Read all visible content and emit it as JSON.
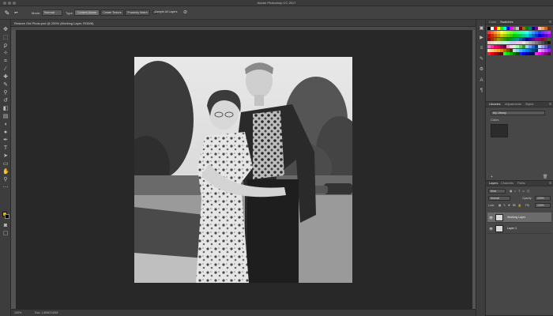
{
  "app": {
    "title": "Adobe Photoshop CC 2017"
  },
  "options_bar": {
    "mode_label": "Mode:",
    "mode_value": "Normal",
    "type_label": "Type:",
    "type_buttons": [
      "Content-Aware",
      "Create Texture",
      "Proximity Match"
    ],
    "sample_all_layers": "Sample All Layers"
  },
  "document": {
    "tab_label": "Restore Old Photo.psd @ 200% (Working Layer, RGB/8)",
    "zoom": "100%",
    "doc_info": "Doc: 1.80M/3.60M"
  },
  "panels": {
    "color_tabs": [
      "Color",
      "Swatches"
    ],
    "libraries_tabs": [
      "Libraries",
      "Adjustments",
      "Styles"
    ],
    "library_name": "My Library",
    "library_section": "Colors",
    "layers_tabs": [
      "Layers",
      "Channels",
      "Paths"
    ],
    "layers_kind": "Kind",
    "blend_mode": "Normal",
    "opacity_label": "Opacity:",
    "opacity_value": "100%",
    "lock_label": "Lock:",
    "fill_label": "Fill:",
    "fill_value": "100%",
    "layers": [
      {
        "name": "Working Layer",
        "selected": true
      },
      {
        "name": "Layer 1",
        "selected": false
      }
    ]
  },
  "swatch_colors": [
    "#000000",
    "#ffffff",
    "#ff0000",
    "#ffff00",
    "#00ff00",
    "#00ffff",
    "#0000ff",
    "#ff00ff",
    "#808080",
    "#c0c0c0",
    "#800000",
    "#808000",
    "#008000",
    "#008080",
    "#000080",
    "#800080",
    "#ffcc99",
    "#ff9966",
    "#cc6633",
    "#663300",
    "#ff3333",
    "#ff6633",
    "#ff9933",
    "#ffcc33",
    "#ffff33",
    "#ccff33",
    "#99ff33",
    "#66ff33",
    "#33ff33",
    "#33ff66",
    "#33ff99",
    "#33ffcc",
    "#33ffff",
    "#33ccff",
    "#3399ff",
    "#3366ff",
    "#3333ff",
    "#6633ff",
    "#9933ff",
    "#cc33ff",
    "#cc0000",
    "#cc3300",
    "#cc6600",
    "#cc9900",
    "#cccc00",
    "#99cc00",
    "#66cc00",
    "#33cc00",
    "#00cc00",
    "#00cc33",
    "#00cc66",
    "#00cc99",
    "#00cccc",
    "#0099cc",
    "#0066cc",
    "#0033cc",
    "#0000cc",
    "#3300cc",
    "#6600cc",
    "#9900cc",
    "#990000",
    "#993300",
    "#996600",
    "#999900",
    "#669900",
    "#339900",
    "#009900",
    "#009933",
    "#009966",
    "#009999",
    "#006699",
    "#003399",
    "#000099",
    "#330099",
    "#660099",
    "#990099",
    "#990066",
    "#990033",
    "#663333",
    "#336633",
    "#f2c4c4",
    "#f2d9c4",
    "#f2efc4",
    "#d9f2c4",
    "#c4f2c9",
    "#c4f2e0",
    "#c4e6f2",
    "#c4d0f2",
    "#d4c4f2",
    "#ecc4f2",
    "#f2c4de",
    "#e6e6e6",
    "#cccccc",
    "#b3b3b3",
    "#999999",
    "#7f7f7f",
    "#666666",
    "#4d4d4d",
    "#333333",
    "#1a1a1a",
    "#ff66cc",
    "#ff3399",
    "#ff0066",
    "#cc0066",
    "#990066",
    "#660033",
    "#ff99cc",
    "#ffccee",
    "#ccffcc",
    "#99ff99",
    "#66cc66",
    "#339933",
    "#99ccff",
    "#6699ff",
    "#3366cc",
    "#003399",
    "#ccccff",
    "#9999ff",
    "#6666cc",
    "#333399",
    "#ffe0b3",
    "#ffcc80",
    "#ffb84d",
    "#ffa31a",
    "#e68a00",
    "#b36b00",
    "#804d00",
    "#4d2e00",
    "#b3e0ff",
    "#80ccff",
    "#4db8ff",
    "#1aa3ff",
    "#0088e6",
    "#006bb3",
    "#004d80",
    "#002e4d",
    "#e0b3ff",
    "#cc80ff",
    "#b84dff",
    "#a31aff",
    "#ff1a1a",
    "#e60000",
    "#b30000",
    "#800000",
    "#4d0000",
    "#1aff1a",
    "#00e600",
    "#00b300",
    "#008000",
    "#004d00",
    "#1a1aff",
    "#0000e6",
    "#0000b3",
    "#000080",
    "#00004d",
    "#ff1aff",
    "#e600e6",
    "#b300b3",
    "#800080",
    "#4d004d"
  ]
}
